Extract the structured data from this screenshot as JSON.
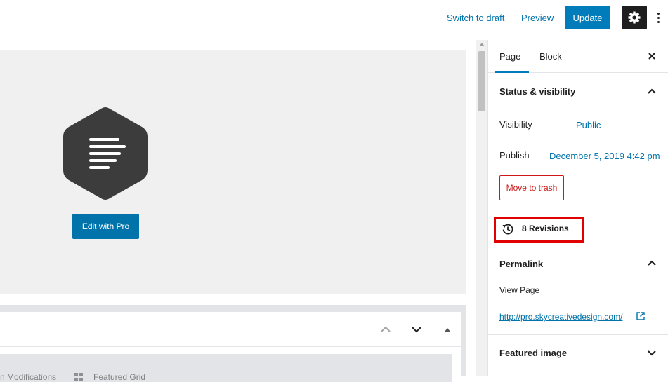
{
  "header": {
    "switch_to_draft": "Switch to draft",
    "preview": "Preview",
    "update": "Update"
  },
  "editor": {
    "edit_with_pro": "Edit with Pro",
    "meta_tabs": [
      "n Modifications",
      "Featured Grid"
    ]
  },
  "sidebar": {
    "tabs": [
      "Page",
      "Block"
    ],
    "status": {
      "title": "Status & visibility",
      "visibility_label": "Visibility",
      "visibility_value": "Public",
      "publish_label": "Publish",
      "publish_value": "December 5, 2019 4:42 pm",
      "trash": "Move to trash"
    },
    "revisions": "8 Revisions",
    "permalink": {
      "title": "Permalink",
      "view_page": "View Page",
      "url": "http://pro.skycreativedesign.com/"
    },
    "featured_image": "Featured image"
  },
  "colors": {
    "accent": "#007cba",
    "link": "#0073aa",
    "danger": "#cc1818",
    "highlight": "#e00000"
  }
}
